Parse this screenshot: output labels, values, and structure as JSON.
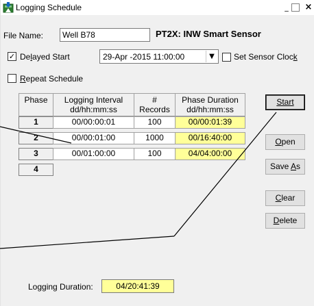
{
  "window": {
    "title": "Logging Schedule",
    "minimize_glyph": "_",
    "close_glyph": "×"
  },
  "file": {
    "label": "File Name:",
    "value": "Well B78",
    "sensor": "PT2X: INW Smart Sensor"
  },
  "delayed_start": {
    "checked": true,
    "check_glyph": "✓",
    "label_pre": "De",
    "label_ul": "l",
    "label_post": "ayed Start",
    "datetime": "29-Apr -2015 11:00:00",
    "arrow_glyph": "▼"
  },
  "set_sensor_clock": {
    "checked": false,
    "label_pre": "Set Sensor Cloc",
    "label_ul": "k"
  },
  "repeat_schedule": {
    "checked": false,
    "label_ul": "R",
    "label_post": "epeat Schedule"
  },
  "table": {
    "headers": {
      "phase": "Phase",
      "interval_1": "Logging Interval",
      "interval_2": "dd/hh:mm:ss",
      "records_1": "#",
      "records_2": "Records",
      "duration_1": "Phase Duration",
      "duration_2": "dd/hh:mm:ss"
    },
    "rows": [
      {
        "phase": "1",
        "interval": "00/00:00:01",
        "records": "100",
        "duration": "00/00:01:39"
      },
      {
        "phase": "2",
        "interval": "00/00:01:00",
        "records": "1000",
        "duration": "00/16:40:00"
      },
      {
        "phase": "3",
        "interval": "00/01:00:00",
        "records": "100",
        "duration": "04/04:00:00"
      },
      {
        "phase": "4",
        "interval": "",
        "records": "",
        "duration": ""
      }
    ]
  },
  "buttons": {
    "start": "Start",
    "open_ul": "O",
    "open_post": "pen",
    "saveas_pre": "Save ",
    "saveas_ul": "A",
    "saveas_post": "s",
    "clear_ul": "C",
    "clear_post": "lear",
    "delete_ul": "D",
    "delete_post": "elete"
  },
  "logging_duration": {
    "label": "Logging Duration:",
    "value": "04/20:41:39"
  },
  "colors": {
    "highlight": "#ffff99",
    "background": "#f0f0f0"
  }
}
